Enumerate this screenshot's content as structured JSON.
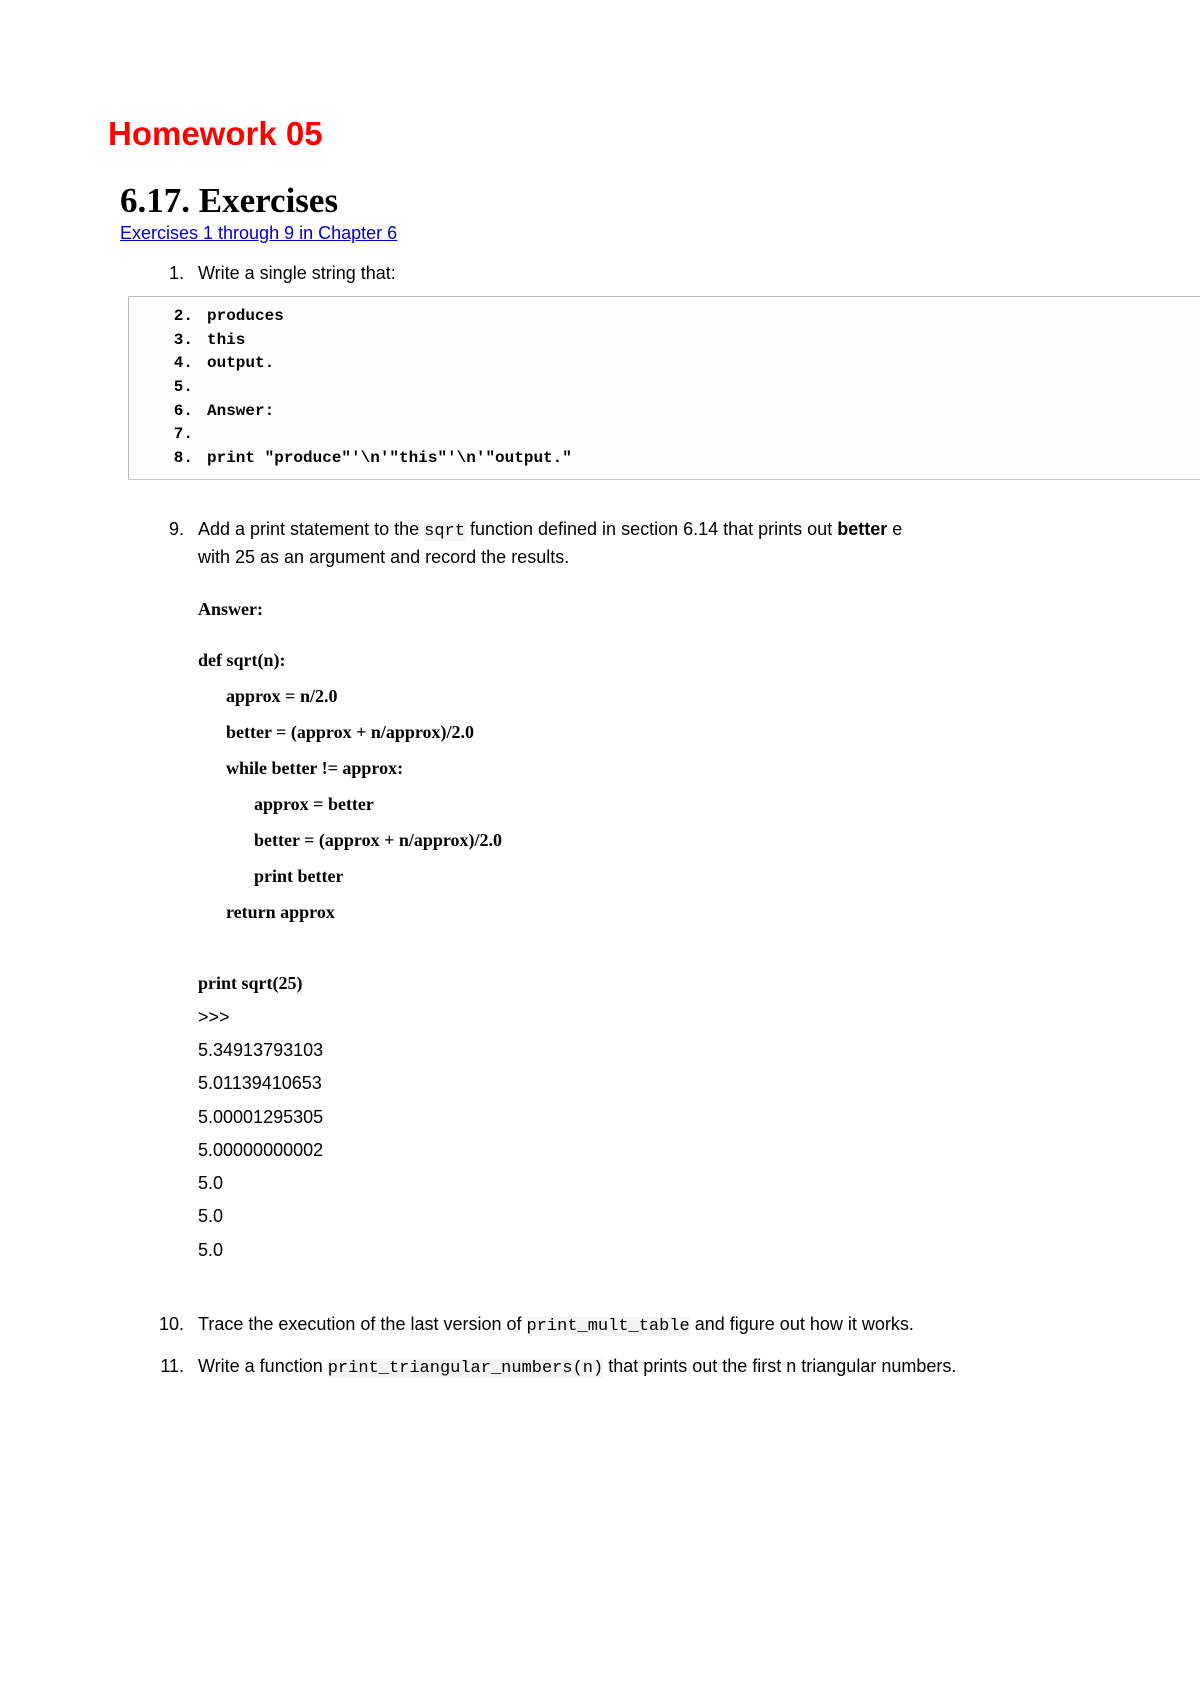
{
  "header": {
    "title": "Homework 05",
    "section": "6.17. Exercises",
    "link_text": "Exercises 1 through 9 in Chapter 6"
  },
  "exercise1": {
    "num": "1.",
    "text": "Write a single string that:"
  },
  "codeblock": {
    "lines": [
      {
        "n": "2.",
        "t": "produces"
      },
      {
        "n": "3.",
        "t": "this"
      },
      {
        "n": "4.",
        "t": "output."
      },
      {
        "n": "5.",
        "t": ""
      },
      {
        "n": "6.",
        "t": "Answer:"
      },
      {
        "n": "7.",
        "t": ""
      },
      {
        "n": "8.",
        "t": "print \"produce\"'\\n'\"this\"'\\n'\"output.\""
      }
    ]
  },
  "exercise9": {
    "num": "9.",
    "prefix": "Add a print statement to the ",
    "code1": "sqrt",
    "mid": " function defined in section 6.14 that prints out ",
    "bold1": "better",
    "suffix_line1": " e",
    "line2": "with 25 as an argument and record the results."
  },
  "answer9": {
    "label": "Answer:",
    "code_lines": [
      {
        "cls": "",
        "t": "def sqrt(n):"
      },
      {
        "cls": "indent-1",
        "t": "approx = n/2.0"
      },
      {
        "cls": "indent-1",
        "t": "better = (approx + n/approx)/2.0"
      },
      {
        "cls": "indent-1",
        "t": "while better != approx:"
      },
      {
        "cls": "indent-2",
        "t": "approx = better"
      },
      {
        "cls": "indent-2",
        "t": "better = (approx + n/approx)/2.0"
      },
      {
        "cls": "indent-2",
        "t": "print better"
      },
      {
        "cls": "indent-1",
        "t": "return approx"
      }
    ],
    "output_head": "print sqrt(25)",
    "output_lines": [
      ">>>",
      "5.34913793103",
      "5.01139410653",
      "5.00001295305",
      "5.00000000002",
      "5.0",
      "5.0",
      "5.0"
    ]
  },
  "exercise10": {
    "num": "10.",
    "prefix": "Trace the execution of the last version of ",
    "code1": "print_mult_table",
    "suffix": " and figure out how it works."
  },
  "exercise11": {
    "num": "11.",
    "prefix": "Write a function ",
    "code1": "print_triangular_numbers(n)",
    "suffix": " that prints out the first n triangular numbers."
  }
}
